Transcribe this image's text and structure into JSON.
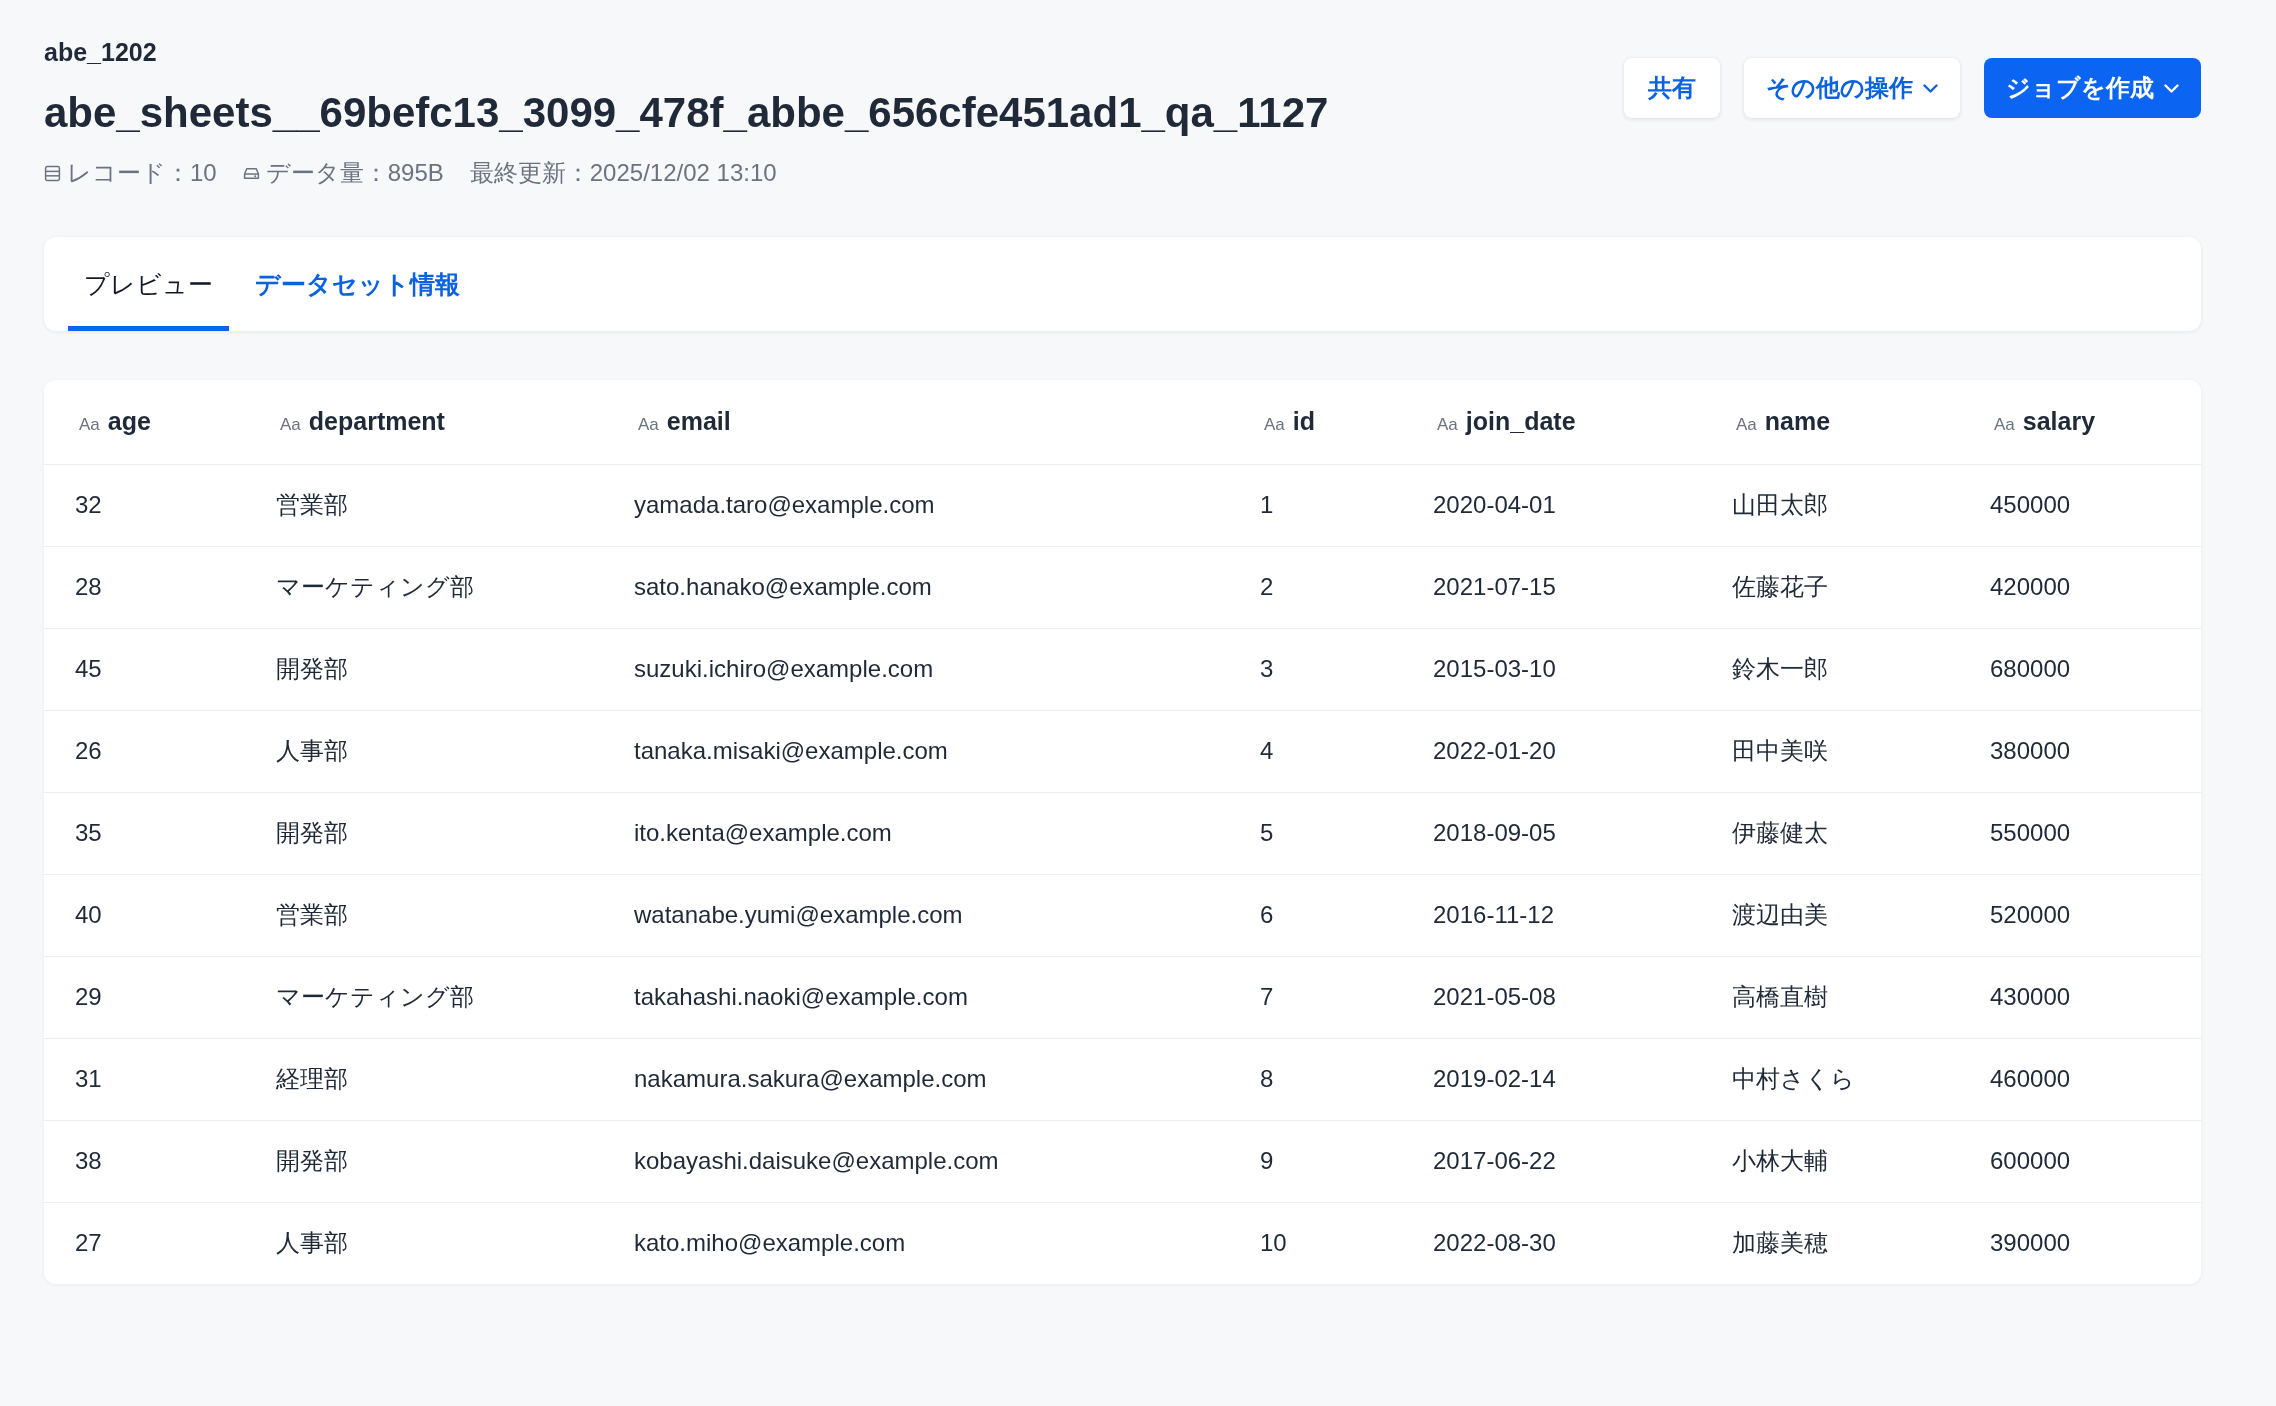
{
  "workspace": "abe_1202",
  "title": "abe_sheets__69befc13_3099_478f_abbe_656cfe451ad1_qa_1127",
  "meta": [
    {
      "kind": "records",
      "text": "レコード：10"
    },
    {
      "kind": "size",
      "text": "データ量：895B"
    },
    {
      "kind": "updated",
      "text": "最終更新：2025/12/02 13:10"
    }
  ],
  "actions": [
    {
      "label": "共有",
      "kind": "plain",
      "dropdown": false
    },
    {
      "label": "その他の操作",
      "kind": "plain",
      "dropdown": true
    },
    {
      "label": "ジョブを作成",
      "kind": "primary",
      "dropdown": true
    }
  ],
  "tabs": [
    {
      "label": "プレビュー",
      "selected": true
    },
    {
      "label": "データセット情報",
      "selected": false
    }
  ],
  "table": {
    "columns": [
      {
        "type_label": "Aa",
        "name": "age"
      },
      {
        "type_label": "Aa",
        "name": "department"
      },
      {
        "type_label": "Aa",
        "name": "email"
      },
      {
        "type_label": "Aa",
        "name": "id"
      },
      {
        "type_label": "Aa",
        "name": "join_date"
      },
      {
        "type_label": "Aa",
        "name": "name"
      },
      {
        "type_label": "Aa",
        "name": "salary"
      }
    ],
    "rows": [
      [
        "32",
        "営業部",
        "yamada.taro@example.com",
        "1",
        "2020-04-01",
        "山田太郎",
        "450000"
      ],
      [
        "28",
        "マーケティング部",
        "sato.hanako@example.com",
        "2",
        "2021-07-15",
        "佐藤花子",
        "420000"
      ],
      [
        "45",
        "開発部",
        "suzuki.ichiro@example.com",
        "3",
        "2015-03-10",
        "鈴木一郎",
        "680000"
      ],
      [
        "26",
        "人事部",
        "tanaka.misaki@example.com",
        "4",
        "2022-01-20",
        "田中美咲",
        "380000"
      ],
      [
        "35",
        "開発部",
        "ito.kenta@example.com",
        "5",
        "2018-09-05",
        "伊藤健太",
        "550000"
      ],
      [
        "40",
        "営業部",
        "watanabe.yumi@example.com",
        "6",
        "2016-11-12",
        "渡辺由美",
        "520000"
      ],
      [
        "29",
        "マーケティング部",
        "takahashi.naoki@example.com",
        "7",
        "2021-05-08",
        "高橋直樹",
        "430000"
      ],
      [
        "31",
        "経理部",
        "nakamura.sakura@example.com",
        "8",
        "2019-02-14",
        "中村さくら",
        "460000"
      ],
      [
        "38",
        "開発部",
        "kobayashi.daisuke@example.com",
        "9",
        "2017-06-22",
        "小林大輔",
        "600000"
      ],
      [
        "27",
        "人事部",
        "kato.miho@example.com",
        "10",
        "2022-08-30",
        "加藤美穂",
        "390000"
      ]
    ]
  }
}
